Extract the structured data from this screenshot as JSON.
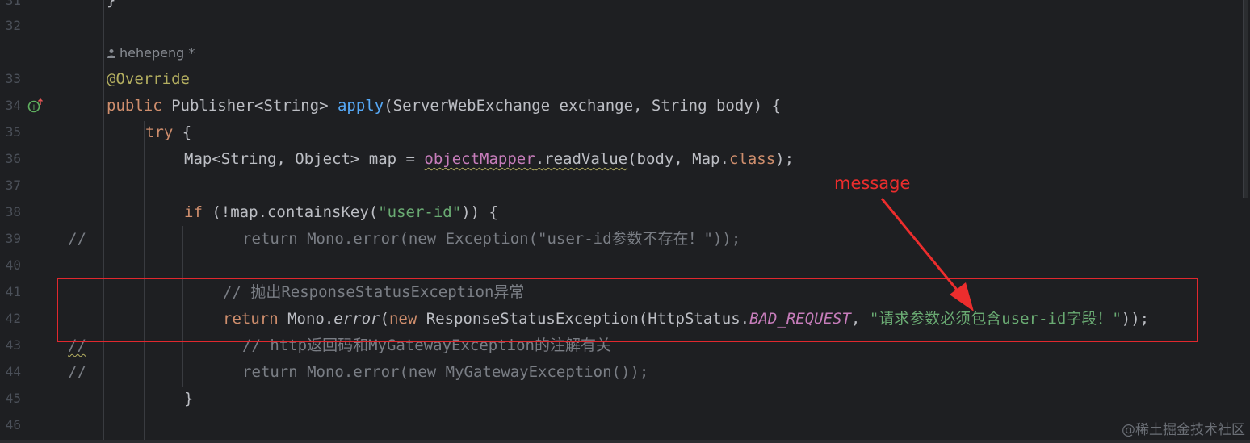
{
  "editor": {
    "line_numbers": [
      "31",
      "32",
      "33",
      "34",
      "35",
      "36",
      "37",
      "38",
      "39",
      "40",
      "41",
      "42",
      "43",
      "44",
      "45",
      "46"
    ],
    "author": "hehepeng *",
    "lines": {
      "l33": {
        "annotation": "@Override"
      },
      "l34": {
        "kw": "public ",
        "a": "Publisher<String> ",
        "fn": "apply",
        "b": "(ServerWebExchange exchange, String body) {"
      },
      "l35": {
        "kw": "try",
        "a": " {"
      },
      "l36": {
        "a": "Map<String, Object> map = ",
        "fld": "objectMapper",
        "dot": ".",
        "fn": "readValue",
        "b": "(body, Map.",
        "kw": "class",
        "c": ");"
      },
      "l38": {
        "kw": "if",
        "a": " (!map.containsKey(",
        "str": "\"user-id\"",
        "b": ")) {"
      },
      "l39": {
        "slashes": "//",
        "text": "return Mono.error(new Exception(\"user-id参数不存在！\"));"
      },
      "l41": {
        "comment": "// 抛出ResponseStatusException异常"
      },
      "l42": {
        "kw": "return ",
        "a": "Mono.",
        "it": "error",
        "b": "(",
        "kw2": "new ",
        "c": "ResponseStatusException(HttpStatus.",
        "fld": "BAD_REQUEST",
        "d": ", ",
        "str": "\"请求参数必须包含user-id字段！\"",
        "e": "));"
      },
      "l43": {
        "slashes": "//",
        "text": "// http返回码和MyGatewayException的注解有关"
      },
      "l44": {
        "slashes": "//",
        "text": "return Mono.error(new MyGatewayException());"
      },
      "l45": {
        "a": "}"
      },
      "l31": {
        "a": "}"
      }
    }
  },
  "overlay": {
    "label": "message",
    "color": "#ec2d2d"
  },
  "watermark": "@稀土掘金技术社区",
  "colors": {
    "background": "#1e1f22",
    "keyword": "#cf8e6d",
    "function": "#56a8f5",
    "string": "#6aab73",
    "annotation": "#b3ae60",
    "field": "#c77dbb",
    "comment": "#7a7e85"
  },
  "icons": {
    "gutter": "implements-method-icon",
    "author": "person-icon"
  }
}
